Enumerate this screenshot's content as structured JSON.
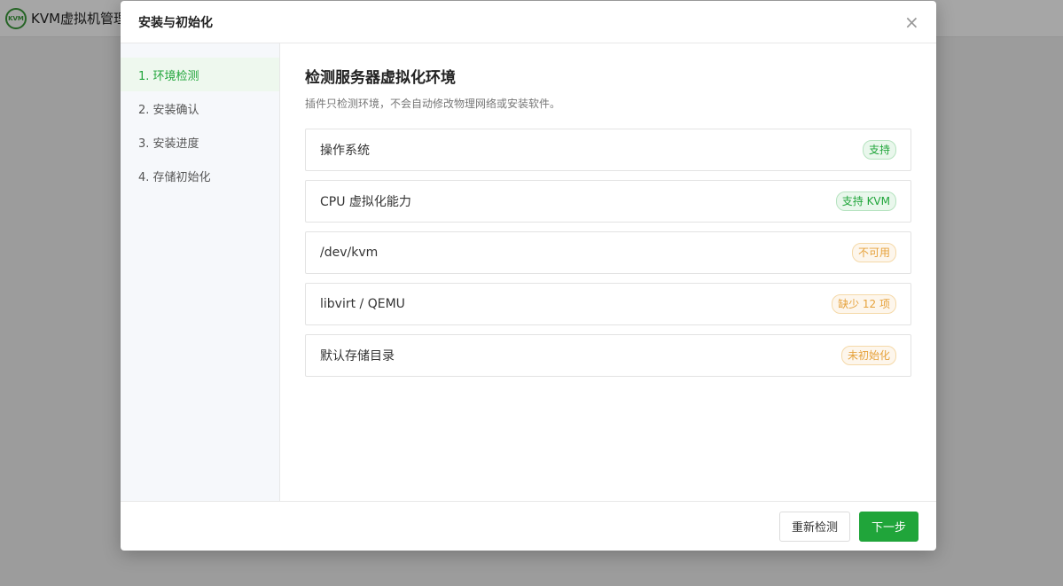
{
  "app": {
    "logo_text": "KVM",
    "title": "KVM虚拟机管理"
  },
  "modal": {
    "title": "安装与初始化",
    "close_icon": "close-icon",
    "steps": [
      {
        "label": "1. 环境检测",
        "active": true
      },
      {
        "label": "2. 安装确认",
        "active": false
      },
      {
        "label": "3. 安装进度",
        "active": false
      },
      {
        "label": "4. 存储初始化",
        "active": false
      }
    ],
    "content": {
      "title": "检测服务器虚拟化环境",
      "description": "插件只检测环境，不会自动修改物理网络或安装软件。",
      "checks": [
        {
          "label": "操作系统",
          "status": "支持",
          "level": "ok"
        },
        {
          "label": "CPU 虚拟化能力",
          "status": "支持 KVM",
          "level": "ok"
        },
        {
          "label": "/dev/kvm",
          "status": "不可用",
          "level": "warn"
        },
        {
          "label": "libvirt / QEMU",
          "status": "缺少 12 项",
          "level": "warn"
        },
        {
          "label": "默认存储目录",
          "status": "未初始化",
          "level": "warn"
        }
      ]
    },
    "footer": {
      "recheck_label": "重新检测",
      "next_label": "下一步"
    }
  },
  "colors": {
    "primary": "#20a53a",
    "ok_badge": "#20a53a",
    "warn_badge": "#e6a23c"
  }
}
